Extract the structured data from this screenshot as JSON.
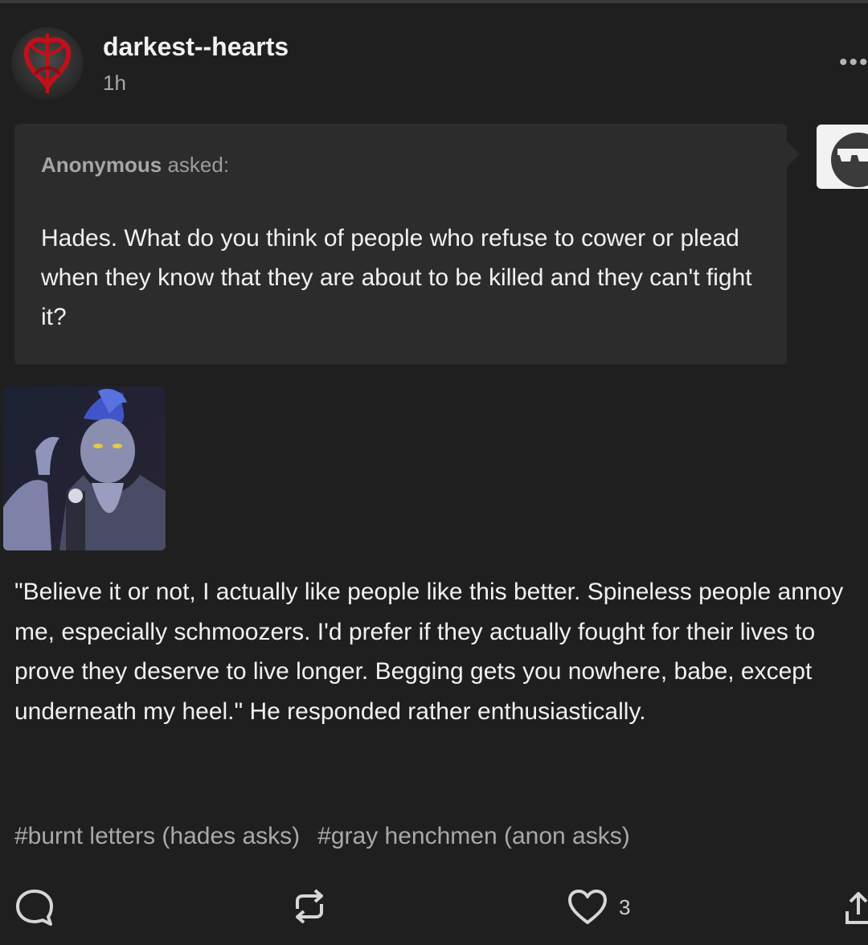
{
  "post": {
    "username": "darkest--hearts",
    "timestamp": "1h",
    "more_icon": "ellipsis-icon"
  },
  "ask": {
    "asker_name": "Anonymous",
    "asker_suffix": " asked:",
    "question": "Hades. What do you think of people who refuse to cower or plead when they know that they are about to be killed and they can't fight it?"
  },
  "answer": {
    "text": "\"Believe it or not, I actually like people like this better. Spineless people annoy me, especially schmoozers. I'd prefer if they actually fought for their lives to prove they deserve to live longer. Begging gets you nowhere, babe, except underneath my heel.\" He responded rather enthusiastically."
  },
  "tags": [
    "#burnt letters (hades asks)",
    "#gray henchmen (anon asks)"
  ],
  "footer": {
    "like_count": "3"
  },
  "colors": {
    "background": "#1f1f1f",
    "ask_box": "#2c2c2c",
    "text": "#f1f1f1",
    "muted": "#a9a9a9"
  }
}
